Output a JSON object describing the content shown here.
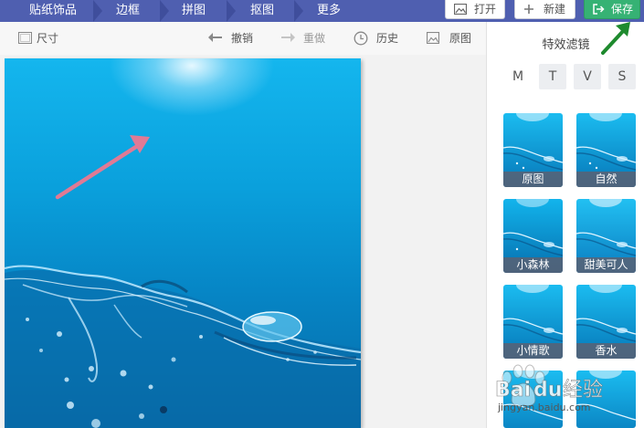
{
  "nav": {
    "tabs": [
      "贴纸饰品",
      "边框",
      "拼图",
      "抠图",
      "更多"
    ],
    "open_label": "打开",
    "new_label": "新建",
    "save_label": "保存"
  },
  "toolbar": {
    "size_label": "尺寸",
    "undo_label": "撤销",
    "redo_label": "重做",
    "history_label": "历史",
    "original_label": "原图"
  },
  "panel": {
    "title": "特效滤镜",
    "category_tabs": [
      "M",
      "T",
      "V",
      "S"
    ],
    "filters": [
      "原图",
      "自然",
      "小森林",
      "甜美可人",
      "小情歌",
      "香水",
      "",
      ""
    ]
  },
  "watermark": {
    "url": "jingyan.baidu.com"
  },
  "colors": {
    "nav_bar": "#4f5fb0",
    "save_button": "#36b274",
    "annotation_arrow_pink": "#e07a95",
    "annotation_arrow_green": "#1e8a2e"
  },
  "icons": {
    "open": "image-icon",
    "new": "plus-icon",
    "save": "export-icon",
    "size": "frame-icon",
    "undo": "arrow-left-icon",
    "redo": "arrow-right-icon",
    "history": "clock-icon",
    "original": "image-icon"
  }
}
